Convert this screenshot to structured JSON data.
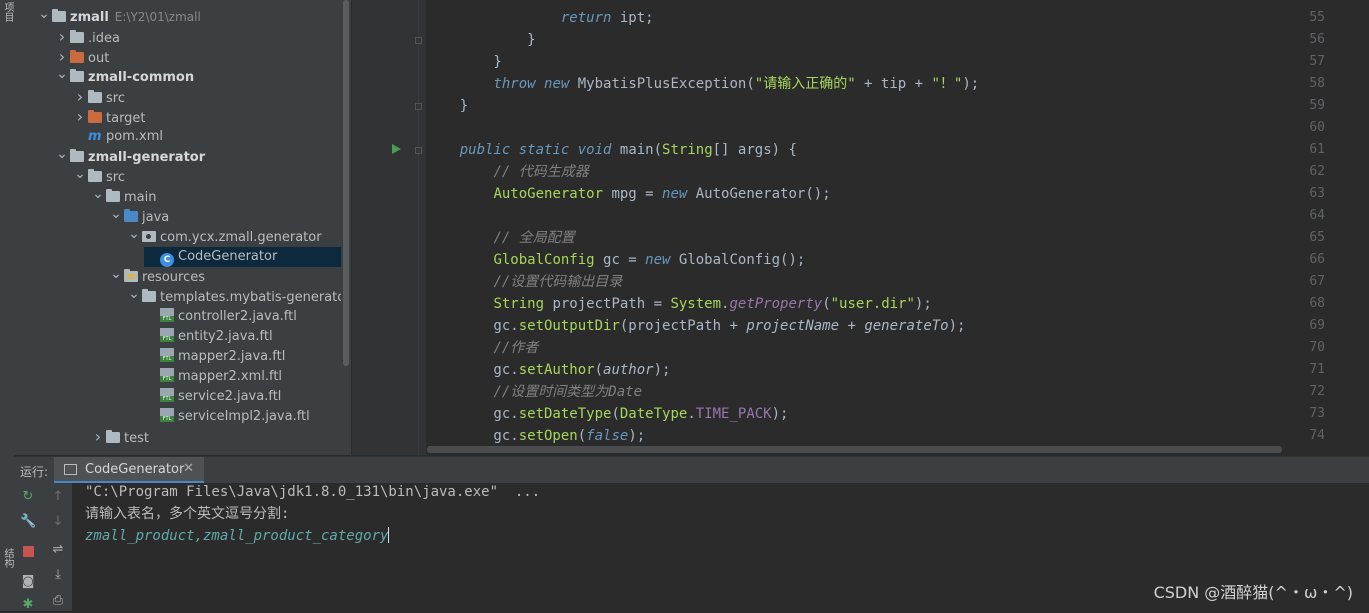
{
  "sidebar_strip": {
    "top_label": "项目",
    "bottom_label": "结构"
  },
  "project_tree": [
    {
      "indent": 0,
      "arrow": "down",
      "icon": "folder",
      "label": "zmall",
      "bold": true,
      "suffix": "E:\\Y2\\01\\zmall"
    },
    {
      "indent": 1,
      "arrow": "right",
      "icon": "folder",
      "label": ".idea"
    },
    {
      "indent": 1,
      "arrow": "right",
      "icon": "folder-excluded",
      "label": "out"
    },
    {
      "indent": 1,
      "arrow": "down",
      "icon": "folder",
      "label": "zmall-common",
      "bold": true
    },
    {
      "indent": 2,
      "arrow": "right",
      "icon": "folder",
      "label": "src"
    },
    {
      "indent": 2,
      "arrow": "right",
      "icon": "folder-excluded",
      "label": "target"
    },
    {
      "indent": 2,
      "arrow": "",
      "icon": "maven",
      "label": "pom.xml"
    },
    {
      "indent": 1,
      "arrow": "down",
      "icon": "folder",
      "label": "zmall-generator",
      "bold": true
    },
    {
      "indent": 2,
      "arrow": "down",
      "icon": "folder",
      "label": "src"
    },
    {
      "indent": 3,
      "arrow": "down",
      "icon": "folder",
      "label": "main"
    },
    {
      "indent": 4,
      "arrow": "down",
      "icon": "folder-source",
      "label": "java"
    },
    {
      "indent": 5,
      "arrow": "down",
      "icon": "package",
      "label": "com.ycx.zmall.generator"
    },
    {
      "indent": 6,
      "arrow": "",
      "icon": "class",
      "label": "CodeGenerator",
      "selected": true
    },
    {
      "indent": 4,
      "arrow": "down",
      "icon": "folder-resources",
      "label": "resources"
    },
    {
      "indent": 5,
      "arrow": "down",
      "icon": "folder",
      "label": "templates.mybatis-generator"
    },
    {
      "indent": 6,
      "arrow": "",
      "icon": "ftl",
      "label": "controller2.java.ftl"
    },
    {
      "indent": 6,
      "arrow": "",
      "icon": "ftl",
      "label": "entity2.java.ftl"
    },
    {
      "indent": 6,
      "arrow": "",
      "icon": "ftl",
      "label": "mapper2.java.ftl"
    },
    {
      "indent": 6,
      "arrow": "",
      "icon": "ftl",
      "label": "mapper2.xml.ftl"
    },
    {
      "indent": 6,
      "arrow": "",
      "icon": "ftl",
      "label": "service2.java.ftl"
    },
    {
      "indent": 6,
      "arrow": "",
      "icon": "ftl",
      "label": "serviceImpl2.java.ftl"
    },
    {
      "indent": 3,
      "arrow": "right",
      "icon": "folder",
      "label": "test"
    }
  ],
  "editor": {
    "lines": [
      {
        "no": "55",
        "tokens": [
          {
            "t": "                ",
            "c": ""
          },
          {
            "t": "return",
            "c": "kw"
          },
          {
            "t": " ipt;",
            "c": ""
          }
        ]
      },
      {
        "no": "56",
        "tokens": [
          {
            "t": "            }",
            "c": ""
          }
        ]
      },
      {
        "no": "57",
        "tokens": [
          {
            "t": "        }",
            "c": ""
          }
        ]
      },
      {
        "no": "58",
        "tokens": [
          {
            "t": "        ",
            "c": ""
          },
          {
            "t": "throw",
            "c": "kw"
          },
          {
            "t": " ",
            "c": ""
          },
          {
            "t": "new",
            "c": "kw"
          },
          {
            "t": " MybatisPlusException(",
            "c": ""
          },
          {
            "t": "\"请输入正确的\"",
            "c": "grn"
          },
          {
            "t": " + tip + ",
            "c": ""
          },
          {
            "t": "\"！\"",
            "c": "grn"
          },
          {
            "t": ");",
            "c": ""
          }
        ]
      },
      {
        "no": "59",
        "tokens": [
          {
            "t": "    }",
            "c": ""
          }
        ]
      },
      {
        "no": "60",
        "tokens": []
      },
      {
        "no": "61",
        "tokens": [
          {
            "t": "    ",
            "c": ""
          },
          {
            "t": "public",
            "c": "kw"
          },
          {
            "t": " ",
            "c": ""
          },
          {
            "t": "static",
            "c": "kw"
          },
          {
            "t": " ",
            "c": ""
          },
          {
            "t": "void",
            "c": "kw"
          },
          {
            "t": " main(",
            "c": ""
          },
          {
            "t": "String",
            "c": "grn"
          },
          {
            "t": "[] args) {",
            "c": ""
          }
        ]
      },
      {
        "no": "62",
        "tokens": [
          {
            "t": "        ",
            "c": ""
          },
          {
            "t": "// 代码生成器",
            "c": "cm"
          }
        ]
      },
      {
        "no": "63",
        "tokens": [
          {
            "t": "        ",
            "c": ""
          },
          {
            "t": "AutoGenerator",
            "c": "grn"
          },
          {
            "t": " mpg = ",
            "c": ""
          },
          {
            "t": "new",
            "c": "kw"
          },
          {
            "t": " AutoGenerator();",
            "c": ""
          }
        ]
      },
      {
        "no": "64",
        "tokens": []
      },
      {
        "no": "65",
        "tokens": [
          {
            "t": "        ",
            "c": ""
          },
          {
            "t": "// 全局配置",
            "c": "cm"
          }
        ]
      },
      {
        "no": "66",
        "tokens": [
          {
            "t": "        ",
            "c": ""
          },
          {
            "t": "GlobalConfig",
            "c": "grn"
          },
          {
            "t": " gc = ",
            "c": ""
          },
          {
            "t": "new",
            "c": "kw"
          },
          {
            "t": " GlobalConfig();",
            "c": ""
          }
        ]
      },
      {
        "no": "67",
        "tokens": [
          {
            "t": "        ",
            "c": ""
          },
          {
            "t": "//设置代码输出目录",
            "c": "cm"
          }
        ]
      },
      {
        "no": "68",
        "tokens": [
          {
            "t": "        ",
            "c": ""
          },
          {
            "t": "String",
            "c": "grn"
          },
          {
            "t": " projectPath = ",
            "c": ""
          },
          {
            "t": "System",
            "c": "grn"
          },
          {
            "t": ".",
            "c": ""
          },
          {
            "t": "getProperty",
            "c": "fld ital"
          },
          {
            "t": "(",
            "c": ""
          },
          {
            "t": "\"user.dir\"",
            "c": "grn"
          },
          {
            "t": ");",
            "c": ""
          }
        ]
      },
      {
        "no": "69",
        "tokens": [
          {
            "t": "        gc.",
            "c": ""
          },
          {
            "t": "setOutputDir",
            "c": "grn"
          },
          {
            "t": "(projectPath + ",
            "c": ""
          },
          {
            "t": "projectName",
            "c": "ital"
          },
          {
            "t": " + ",
            "c": ""
          },
          {
            "t": "generateTo",
            "c": "ital"
          },
          {
            "t": ");",
            "c": ""
          }
        ]
      },
      {
        "no": "70",
        "tokens": [
          {
            "t": "        ",
            "c": ""
          },
          {
            "t": "//作者",
            "c": "cm"
          }
        ]
      },
      {
        "no": "71",
        "tokens": [
          {
            "t": "        gc.",
            "c": ""
          },
          {
            "t": "setAuthor",
            "c": "grn"
          },
          {
            "t": "(",
            "c": ""
          },
          {
            "t": "author",
            "c": "ital"
          },
          {
            "t": ");",
            "c": ""
          }
        ]
      },
      {
        "no": "72",
        "tokens": [
          {
            "t": "        ",
            "c": ""
          },
          {
            "t": "//设置时间类型为Date",
            "c": "cm"
          }
        ]
      },
      {
        "no": "73",
        "tokens": [
          {
            "t": "        gc.",
            "c": ""
          },
          {
            "t": "setDateType",
            "c": "grn"
          },
          {
            "t": "(",
            "c": ""
          },
          {
            "t": "DateType",
            "c": "grn"
          },
          {
            "t": ".",
            "c": ""
          },
          {
            "t": "TIME_PACK",
            "c": "fld"
          },
          {
            "t": ");",
            "c": ""
          }
        ]
      },
      {
        "no": "74",
        "tokens": [
          {
            "t": "        gc.",
            "c": ""
          },
          {
            "t": "setOpen",
            "c": "grn"
          },
          {
            "t": "(",
            "c": ""
          },
          {
            "t": "false",
            "c": "kw"
          },
          {
            "t": ");",
            "c": ""
          }
        ]
      }
    ]
  },
  "run_panel": {
    "label": "运行:",
    "tab_label": "CodeGenerator",
    "tab_close": "✕",
    "console": [
      {
        "text": "\"C:\\Program Files\\Java\\jdk1.8.0_131\\bin\\java.exe\"  ...",
        "kind": "output"
      },
      {
        "text": "请输入表名，多个英文逗号分割:",
        "kind": "output"
      },
      {
        "text": "zmall_product,zmall_product_category",
        "kind": "input"
      }
    ]
  },
  "watermark": "CSDN @酒醉猫(^・ω・^)"
}
